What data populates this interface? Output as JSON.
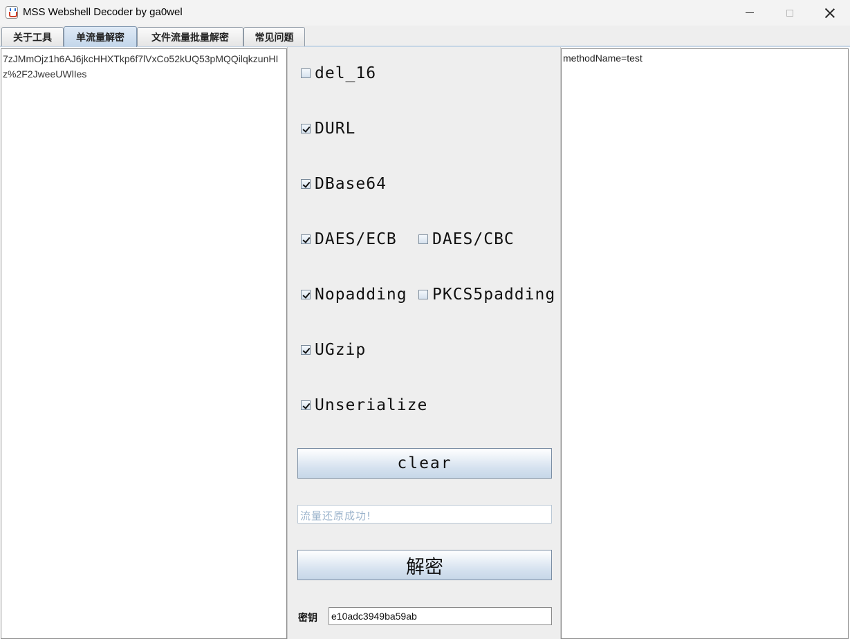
{
  "window": {
    "title": "MSS Webshell Decoder by ga0wel"
  },
  "tabs": [
    {
      "label": "关于工具",
      "active": false
    },
    {
      "label": "单流量解密",
      "active": true
    },
    {
      "label": "文件流量批量解密",
      "active": false
    },
    {
      "label": "常见问题",
      "active": false
    }
  ],
  "input": {
    "text": "7zJMmOjz1h6AJ6jkcHHXTkp6f7lVxCo52kUQ53pMQQilqkzunHIz%2F2JweeUWlIes"
  },
  "output": {
    "text": "methodName=test"
  },
  "options": [
    {
      "label": "del_16",
      "checked": false
    },
    {
      "label": "DURL",
      "checked": true
    },
    {
      "label": "DBase64",
      "checked": true
    },
    {
      "label": "DAES/ECB",
      "checked": true
    },
    {
      "label": "DAES/CBC",
      "checked": false
    },
    {
      "label": "Nopadding",
      "checked": true
    },
    {
      "label": "PKCS5padding",
      "checked": false
    },
    {
      "label": "UGzip",
      "checked": true
    },
    {
      "label": "Unserialize",
      "checked": true
    }
  ],
  "buttons": {
    "clear_label": "clear",
    "decrypt_label": "解密"
  },
  "status": {
    "text": "流量还原成功!"
  },
  "key": {
    "label": "密钥",
    "value": "e10adc3949ba59ab"
  }
}
